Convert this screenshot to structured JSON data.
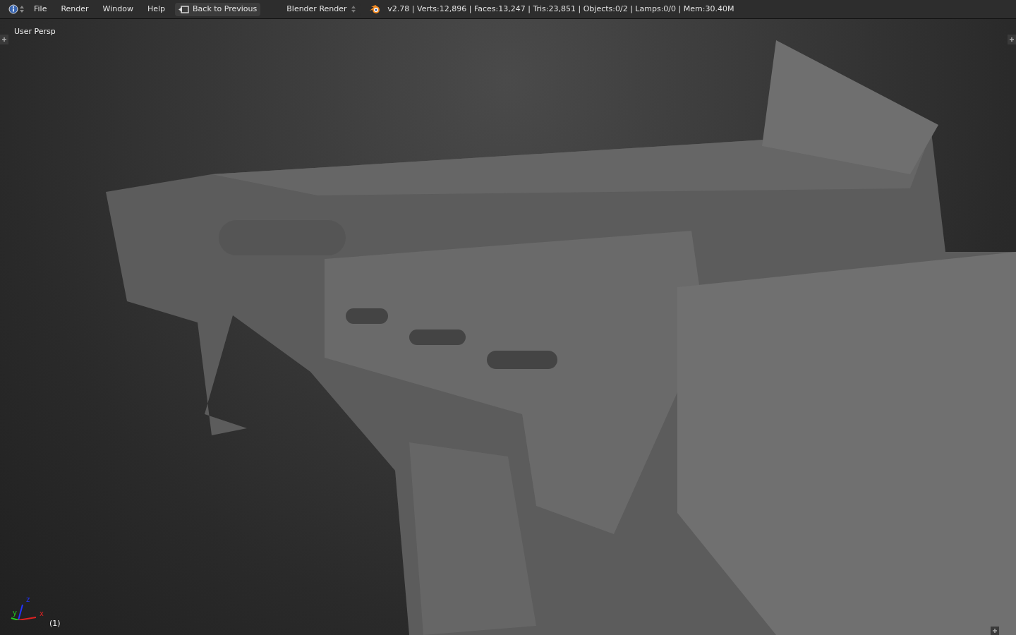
{
  "menu": [
    "File",
    "Render",
    "Window",
    "Help"
  ],
  "back_button": "Back to Previous",
  "render_engine": "Blender Render",
  "stats": "v2.78 | Verts:12,896 | Faces:13,247 | Tris:23,851 | Objects:0/2 | Lamps:0/0 | Mem:30.40M",
  "viewport": {
    "view_name": "User Persp",
    "frame": "(1)",
    "axes": [
      {
        "label": "z",
        "color": "#2233ff"
      },
      {
        "label": "y",
        "color": "#22cc22"
      },
      {
        "label": "x",
        "color": "#dd2222"
      }
    ]
  }
}
